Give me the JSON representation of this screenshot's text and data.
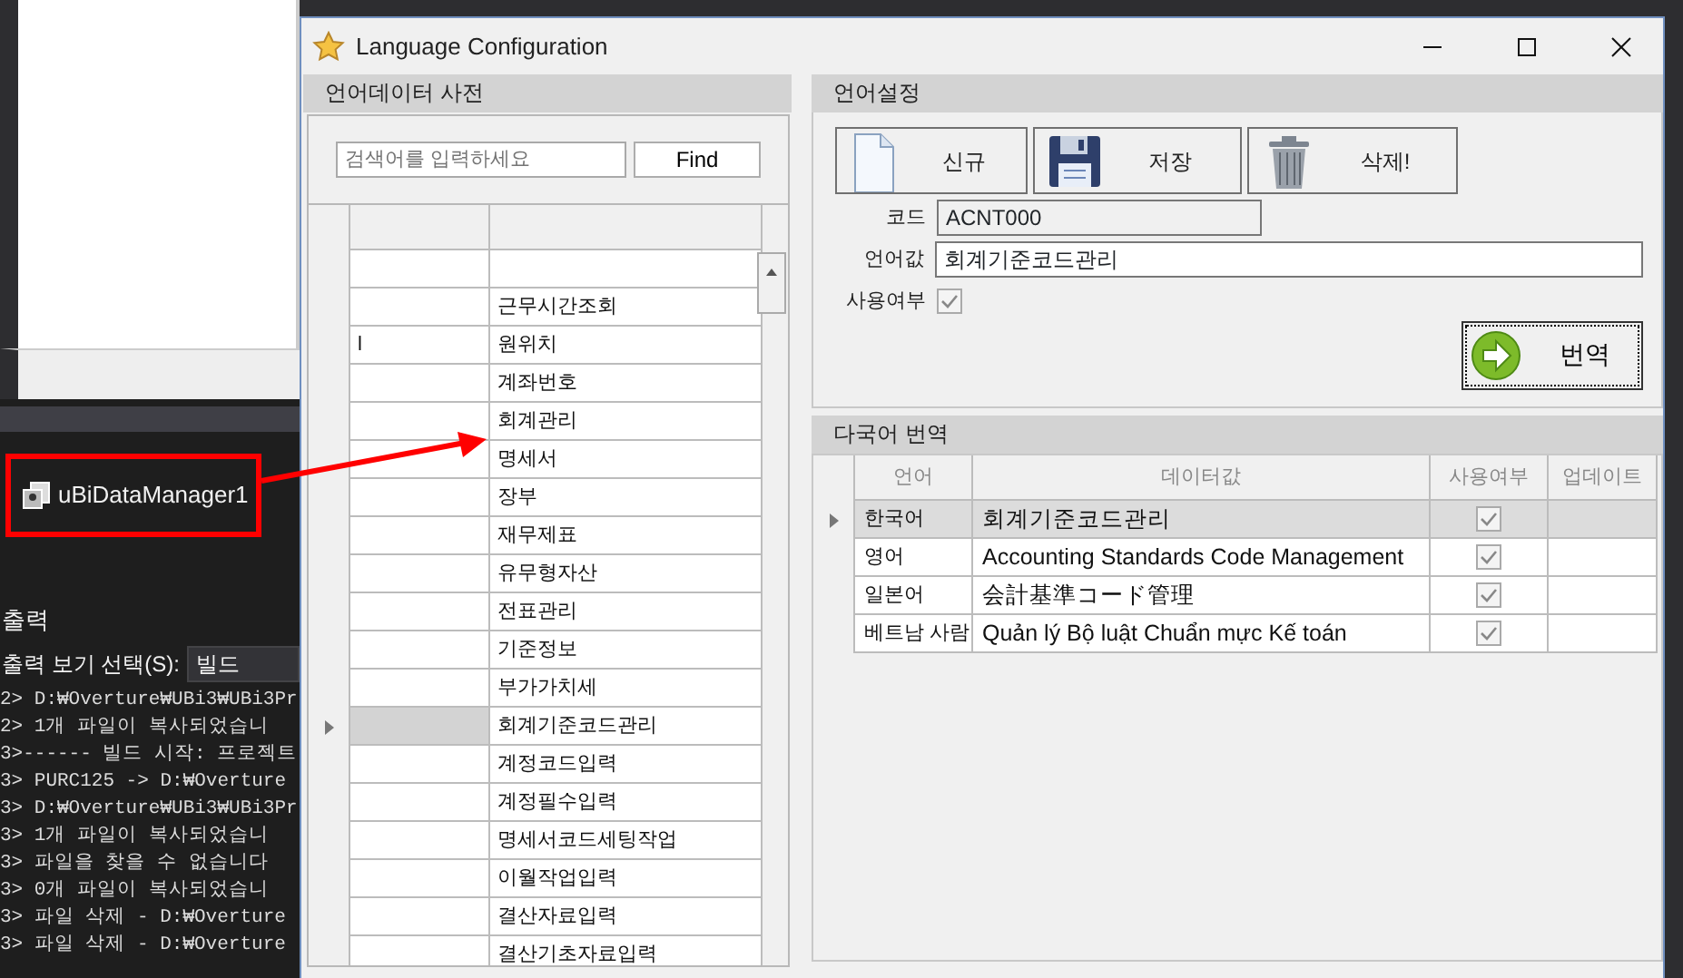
{
  "ide": {
    "component": {
      "label": "uBiDataManager1"
    },
    "output_panel": {
      "title": "출력",
      "source_label": "출력 보기 선택(S):",
      "source_value": "빌드",
      "lines": [
        "2>  D:₩Overture₩UBi3₩UBi3Pr",
        "2>  1개 파일이 복사되었습니",
        "3>------ 빌드 시작: 프로젝트",
        "3>  PURC125 -> D:₩Overture",
        "3>  D:₩Overture₩UBi3₩UBi3Pr",
        "3>  1개 파일이 복사되었습니",
        "3>  파일을 찾을 수 없습니다",
        "3>  0개 파일이 복사되었습니",
        "3>  파일 삭제 - D:₩Overture",
        "3>  파일 삭제 - D:₩Overture"
      ]
    }
  },
  "dialog": {
    "title": "Language Configuration",
    "dictionary": {
      "title": "언어데이터 사전",
      "search": {
        "placeholder": "검색어를 입력하세요"
      },
      "find_button": "Find",
      "rows": [
        {
          "selected": false
        },
        {
          "column_2": "근무시간조회",
          "selected": false
        },
        {
          "column_1": "l",
          "column_2": "원위치",
          "selected": false
        },
        {
          "column_2": "계좌번호",
          "selected": false
        },
        {
          "column_2": "회계관리",
          "selected": false
        },
        {
          "column_2": "명세서",
          "selected": false
        },
        {
          "column_2": "장부",
          "selected": false
        },
        {
          "column_2": "재무제표",
          "selected": false
        },
        {
          "column_2": "유무형자산",
          "selected": false
        },
        {
          "column_2": "전표관리",
          "selected": false
        },
        {
          "column_2": "기준정보",
          "selected": false
        },
        {
          "column_2": "부가가치세",
          "selected": false
        },
        {
          "column_2": "회계기준코드관리",
          "selected": true
        },
        {
          "column_2": "계정코드입력",
          "selected": false
        },
        {
          "column_2": "계정필수입력",
          "selected": false
        },
        {
          "column_2": "명세서코드세팅작업",
          "selected": false
        },
        {
          "column_2": "이월작업입력",
          "selected": false
        },
        {
          "column_2": "결산자료입력",
          "selected": false
        },
        {
          "column_2": "결산기초자료입력",
          "selected": false
        }
      ]
    },
    "settings": {
      "title": "언어설정",
      "buttons": [
        {
          "label": "신규",
          "kind": "new"
        },
        {
          "label": "저장",
          "kind": "save"
        },
        {
          "label": "삭제!",
          "kind": "delete"
        }
      ],
      "code": {
        "label": "코드",
        "value": "ACNT000"
      },
      "language_value": {
        "label": "언어값",
        "value": "회계기준코드관리"
      },
      "in_use": {
        "label": "사용여부",
        "checked": true
      },
      "translate_button": "번역"
    },
    "translations": {
      "title": "다국어 번역",
      "columns": [
        "언어",
        "데이터값",
        "사용여부",
        "업데이트"
      ],
      "rows": [
        {
          "language": "한국어",
          "value": "회계기준코드관리",
          "checked": true,
          "selected": true
        },
        {
          "language": "영어",
          "value": "Accounting Standards Code Management",
          "checked": true,
          "selected": false
        },
        {
          "language": "일본어",
          "value": "会計基準コード管理",
          "checked": true,
          "selected": false
        },
        {
          "language": "베트남 사람",
          "value": "Quản lý Bộ luật Chuẩn mực Kế toán",
          "checked": true,
          "selected": false
        }
      ]
    }
  }
}
